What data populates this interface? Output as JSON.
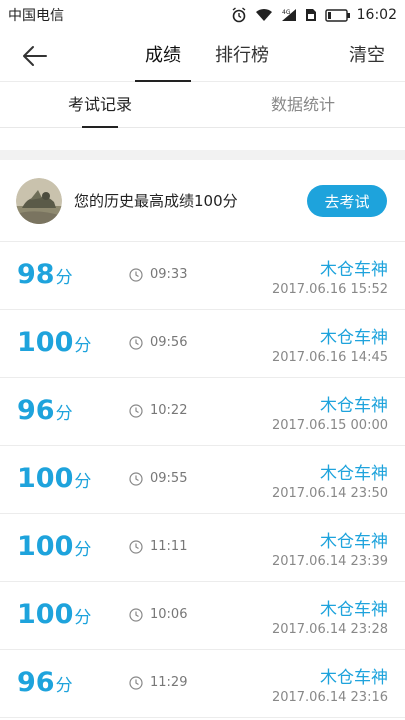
{
  "status_bar": {
    "carrier": "中国电信",
    "time": "16:02",
    "icons": [
      "alarm-icon",
      "wifi-icon",
      "signal-icon",
      "sim-icon",
      "battery-icon"
    ]
  },
  "header": {
    "tabs": [
      {
        "label": "成绩",
        "active": true
      },
      {
        "label": "排行榜",
        "active": false
      }
    ],
    "clear_label": "清空"
  },
  "subtabs": [
    {
      "label": "考试记录",
      "active": true
    },
    {
      "label": "数据统计",
      "active": false
    }
  ],
  "summary": {
    "text": "您的历史最高成绩100分",
    "button_label": "去考试"
  },
  "records": [
    {
      "score": "98",
      "unit": "分",
      "duration": "09:33",
      "name": "木仓车神",
      "date": "2017.06.16  15:52"
    },
    {
      "score": "100",
      "unit": "分",
      "duration": "09:56",
      "name": "木仓车神",
      "date": "2017.06.16  14:45"
    },
    {
      "score": "96",
      "unit": "分",
      "duration": "10:22",
      "name": "木仓车神",
      "date": "2017.06.15  00:00"
    },
    {
      "score": "100",
      "unit": "分",
      "duration": "09:55",
      "name": "木仓车神",
      "date": "2017.06.14  23:50"
    },
    {
      "score": "100",
      "unit": "分",
      "duration": "11:11",
      "name": "木仓车神",
      "date": "2017.06.14  23:39"
    },
    {
      "score": "100",
      "unit": "分",
      "duration": "10:06",
      "name": "木仓车神",
      "date": "2017.06.14  23:28"
    },
    {
      "score": "96",
      "unit": "分",
      "duration": "11:29",
      "name": "木仓车神",
      "date": "2017.06.14  23:16"
    }
  ],
  "colors": {
    "accent": "#1ea3dc",
    "divider": "#ececec",
    "band": "#f2f2f2"
  }
}
